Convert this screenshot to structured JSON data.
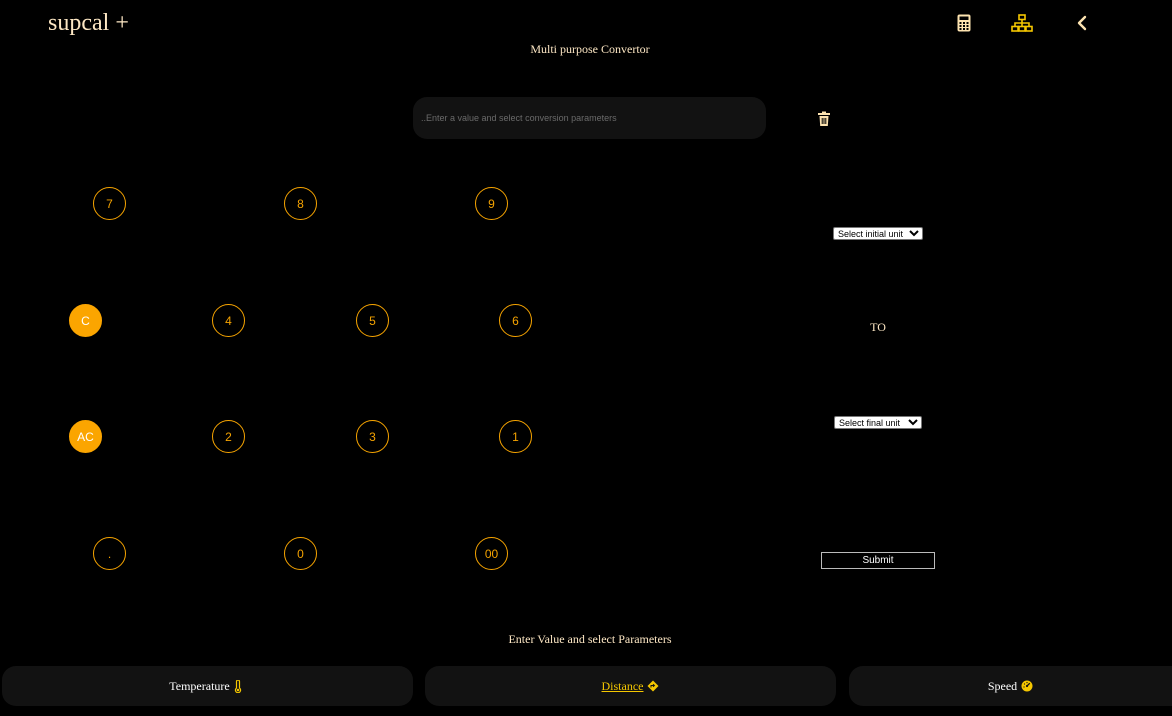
{
  "header": {
    "brand": "supcal +",
    "subtitle": "Multi purpose Convertor",
    "icons": [
      "calculator-icon",
      "sitemap-icon",
      "chevron-left-icon"
    ]
  },
  "display": {
    "placeholder": "..Enter a value and select conversion parameters",
    "value": ""
  },
  "keypad": {
    "row1": [
      "7",
      "8",
      "9"
    ],
    "row2": [
      "C",
      "4",
      "5",
      "6"
    ],
    "row3": [
      "AC",
      "2",
      "3",
      "1"
    ],
    "row4": [
      ".",
      "0",
      "00"
    ]
  },
  "converter": {
    "initial_unit": "Select initial unit",
    "to_label": "TO",
    "final_unit": "Select final unit",
    "submit_label": "Submit"
  },
  "hint": "Enter Value and select Parameters",
  "tabs": [
    {
      "label": "Temperature",
      "icon": "thermometer-icon",
      "active": false
    },
    {
      "label": "Distance",
      "icon": "diamond-direction-icon",
      "active": true
    },
    {
      "label": "Speed",
      "icon": "gauge-icon",
      "active": false
    }
  ],
  "colors": {
    "background": "#000000",
    "accent": "#f5a300",
    "icon_yellow": "#f5c700",
    "panel": "#121212",
    "text_cream": "#fde7c4"
  }
}
